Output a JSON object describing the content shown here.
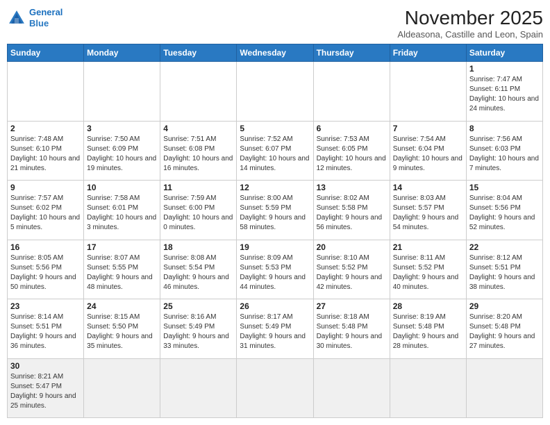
{
  "header": {
    "logo_line1": "General",
    "logo_line2": "Blue",
    "title": "November 2025",
    "subtitle": "Aldeasona, Castille and Leon, Spain"
  },
  "weekdays": [
    "Sunday",
    "Monday",
    "Tuesday",
    "Wednesday",
    "Thursday",
    "Friday",
    "Saturday"
  ],
  "weeks": [
    [
      {
        "day": "",
        "info": ""
      },
      {
        "day": "",
        "info": ""
      },
      {
        "day": "",
        "info": ""
      },
      {
        "day": "",
        "info": ""
      },
      {
        "day": "",
        "info": ""
      },
      {
        "day": "",
        "info": ""
      },
      {
        "day": "1",
        "info": "Sunrise: 7:47 AM\nSunset: 6:11 PM\nDaylight: 10 hours and 24 minutes."
      }
    ],
    [
      {
        "day": "2",
        "info": "Sunrise: 7:48 AM\nSunset: 6:10 PM\nDaylight: 10 hours and 21 minutes."
      },
      {
        "day": "3",
        "info": "Sunrise: 7:50 AM\nSunset: 6:09 PM\nDaylight: 10 hours and 19 minutes."
      },
      {
        "day": "4",
        "info": "Sunrise: 7:51 AM\nSunset: 6:08 PM\nDaylight: 10 hours and 16 minutes."
      },
      {
        "day": "5",
        "info": "Sunrise: 7:52 AM\nSunset: 6:07 PM\nDaylight: 10 hours and 14 minutes."
      },
      {
        "day": "6",
        "info": "Sunrise: 7:53 AM\nSunset: 6:05 PM\nDaylight: 10 hours and 12 minutes."
      },
      {
        "day": "7",
        "info": "Sunrise: 7:54 AM\nSunset: 6:04 PM\nDaylight: 10 hours and 9 minutes."
      },
      {
        "day": "8",
        "info": "Sunrise: 7:56 AM\nSunset: 6:03 PM\nDaylight: 10 hours and 7 minutes."
      }
    ],
    [
      {
        "day": "9",
        "info": "Sunrise: 7:57 AM\nSunset: 6:02 PM\nDaylight: 10 hours and 5 minutes."
      },
      {
        "day": "10",
        "info": "Sunrise: 7:58 AM\nSunset: 6:01 PM\nDaylight: 10 hours and 3 minutes."
      },
      {
        "day": "11",
        "info": "Sunrise: 7:59 AM\nSunset: 6:00 PM\nDaylight: 10 hours and 0 minutes."
      },
      {
        "day": "12",
        "info": "Sunrise: 8:00 AM\nSunset: 5:59 PM\nDaylight: 9 hours and 58 minutes."
      },
      {
        "day": "13",
        "info": "Sunrise: 8:02 AM\nSunset: 5:58 PM\nDaylight: 9 hours and 56 minutes."
      },
      {
        "day": "14",
        "info": "Sunrise: 8:03 AM\nSunset: 5:57 PM\nDaylight: 9 hours and 54 minutes."
      },
      {
        "day": "15",
        "info": "Sunrise: 8:04 AM\nSunset: 5:56 PM\nDaylight: 9 hours and 52 minutes."
      }
    ],
    [
      {
        "day": "16",
        "info": "Sunrise: 8:05 AM\nSunset: 5:56 PM\nDaylight: 9 hours and 50 minutes."
      },
      {
        "day": "17",
        "info": "Sunrise: 8:07 AM\nSunset: 5:55 PM\nDaylight: 9 hours and 48 minutes."
      },
      {
        "day": "18",
        "info": "Sunrise: 8:08 AM\nSunset: 5:54 PM\nDaylight: 9 hours and 46 minutes."
      },
      {
        "day": "19",
        "info": "Sunrise: 8:09 AM\nSunset: 5:53 PM\nDaylight: 9 hours and 44 minutes."
      },
      {
        "day": "20",
        "info": "Sunrise: 8:10 AM\nSunset: 5:52 PM\nDaylight: 9 hours and 42 minutes."
      },
      {
        "day": "21",
        "info": "Sunrise: 8:11 AM\nSunset: 5:52 PM\nDaylight: 9 hours and 40 minutes."
      },
      {
        "day": "22",
        "info": "Sunrise: 8:12 AM\nSunset: 5:51 PM\nDaylight: 9 hours and 38 minutes."
      }
    ],
    [
      {
        "day": "23",
        "info": "Sunrise: 8:14 AM\nSunset: 5:51 PM\nDaylight: 9 hours and 36 minutes."
      },
      {
        "day": "24",
        "info": "Sunrise: 8:15 AM\nSunset: 5:50 PM\nDaylight: 9 hours and 35 minutes."
      },
      {
        "day": "25",
        "info": "Sunrise: 8:16 AM\nSunset: 5:49 PM\nDaylight: 9 hours and 33 minutes."
      },
      {
        "day": "26",
        "info": "Sunrise: 8:17 AM\nSunset: 5:49 PM\nDaylight: 9 hours and 31 minutes."
      },
      {
        "day": "27",
        "info": "Sunrise: 8:18 AM\nSunset: 5:48 PM\nDaylight: 9 hours and 30 minutes."
      },
      {
        "day": "28",
        "info": "Sunrise: 8:19 AM\nSunset: 5:48 PM\nDaylight: 9 hours and 28 minutes."
      },
      {
        "day": "29",
        "info": "Sunrise: 8:20 AM\nSunset: 5:48 PM\nDaylight: 9 hours and 27 minutes."
      }
    ],
    [
      {
        "day": "30",
        "info": "Sunrise: 8:21 AM\nSunset: 5:47 PM\nDaylight: 9 hours and 25 minutes."
      },
      {
        "day": "",
        "info": ""
      },
      {
        "day": "",
        "info": ""
      },
      {
        "day": "",
        "info": ""
      },
      {
        "day": "",
        "info": ""
      },
      {
        "day": "",
        "info": ""
      },
      {
        "day": "",
        "info": ""
      }
    ]
  ]
}
